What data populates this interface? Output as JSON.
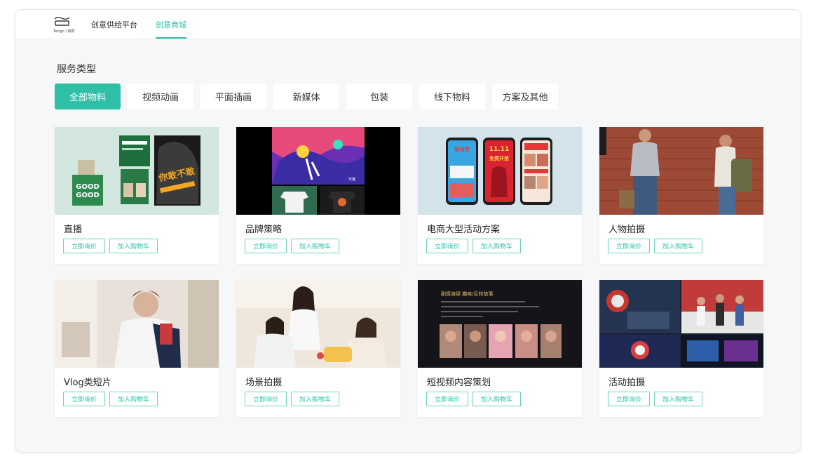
{
  "nav": {
    "logo_caption": "Tezign | 特赞",
    "items": [
      "创意供给平台",
      "创意商城"
    ],
    "active_index": 1
  },
  "filters": {
    "title": "服务类型",
    "items": [
      "全部物料",
      "视频动画",
      "平面插画",
      "新媒体",
      "包装",
      "线下物料",
      "方案及其他"
    ],
    "active_index": 0
  },
  "cards": [
    {
      "title": "直播",
      "quote_label": "立即询价",
      "cart_label": "加入购物车"
    },
    {
      "title": "品牌策略",
      "quote_label": "立即询价",
      "cart_label": "加入购物车"
    },
    {
      "title": "电商大型活动方案",
      "quote_label": "立即询价",
      "cart_label": "加入购物车"
    },
    {
      "title": "人物拍摄",
      "quote_label": "立即询价",
      "cart_label": "加入购物车"
    },
    {
      "title": "Vlog类短片",
      "quote_label": "立即询价",
      "cart_label": "加入购物车"
    },
    {
      "title": "场景拍摄",
      "quote_label": "立即询价",
      "cart_label": "加入购物车"
    },
    {
      "title": "短视频内容策划",
      "quote_label": "立即询价",
      "cart_label": "加入购物车"
    },
    {
      "title": "活动拍摄",
      "quote_label": "立即询价",
      "cart_label": "加入购物车"
    }
  ],
  "image_text": {
    "live_good": "GOOD",
    "live_poster": "你敢不敢",
    "ecom_phone1": "秋出游",
    "ecom_phone2": "11.11",
    "ecom_phone2_sub": "免费开抢",
    "script_heading": "剧情演绎 趣味/反转故事"
  },
  "colors": {
    "accent": "#2dbfa9",
    "accent_border": "#6fd2c1",
    "page_bg": "#f6f7f9"
  }
}
